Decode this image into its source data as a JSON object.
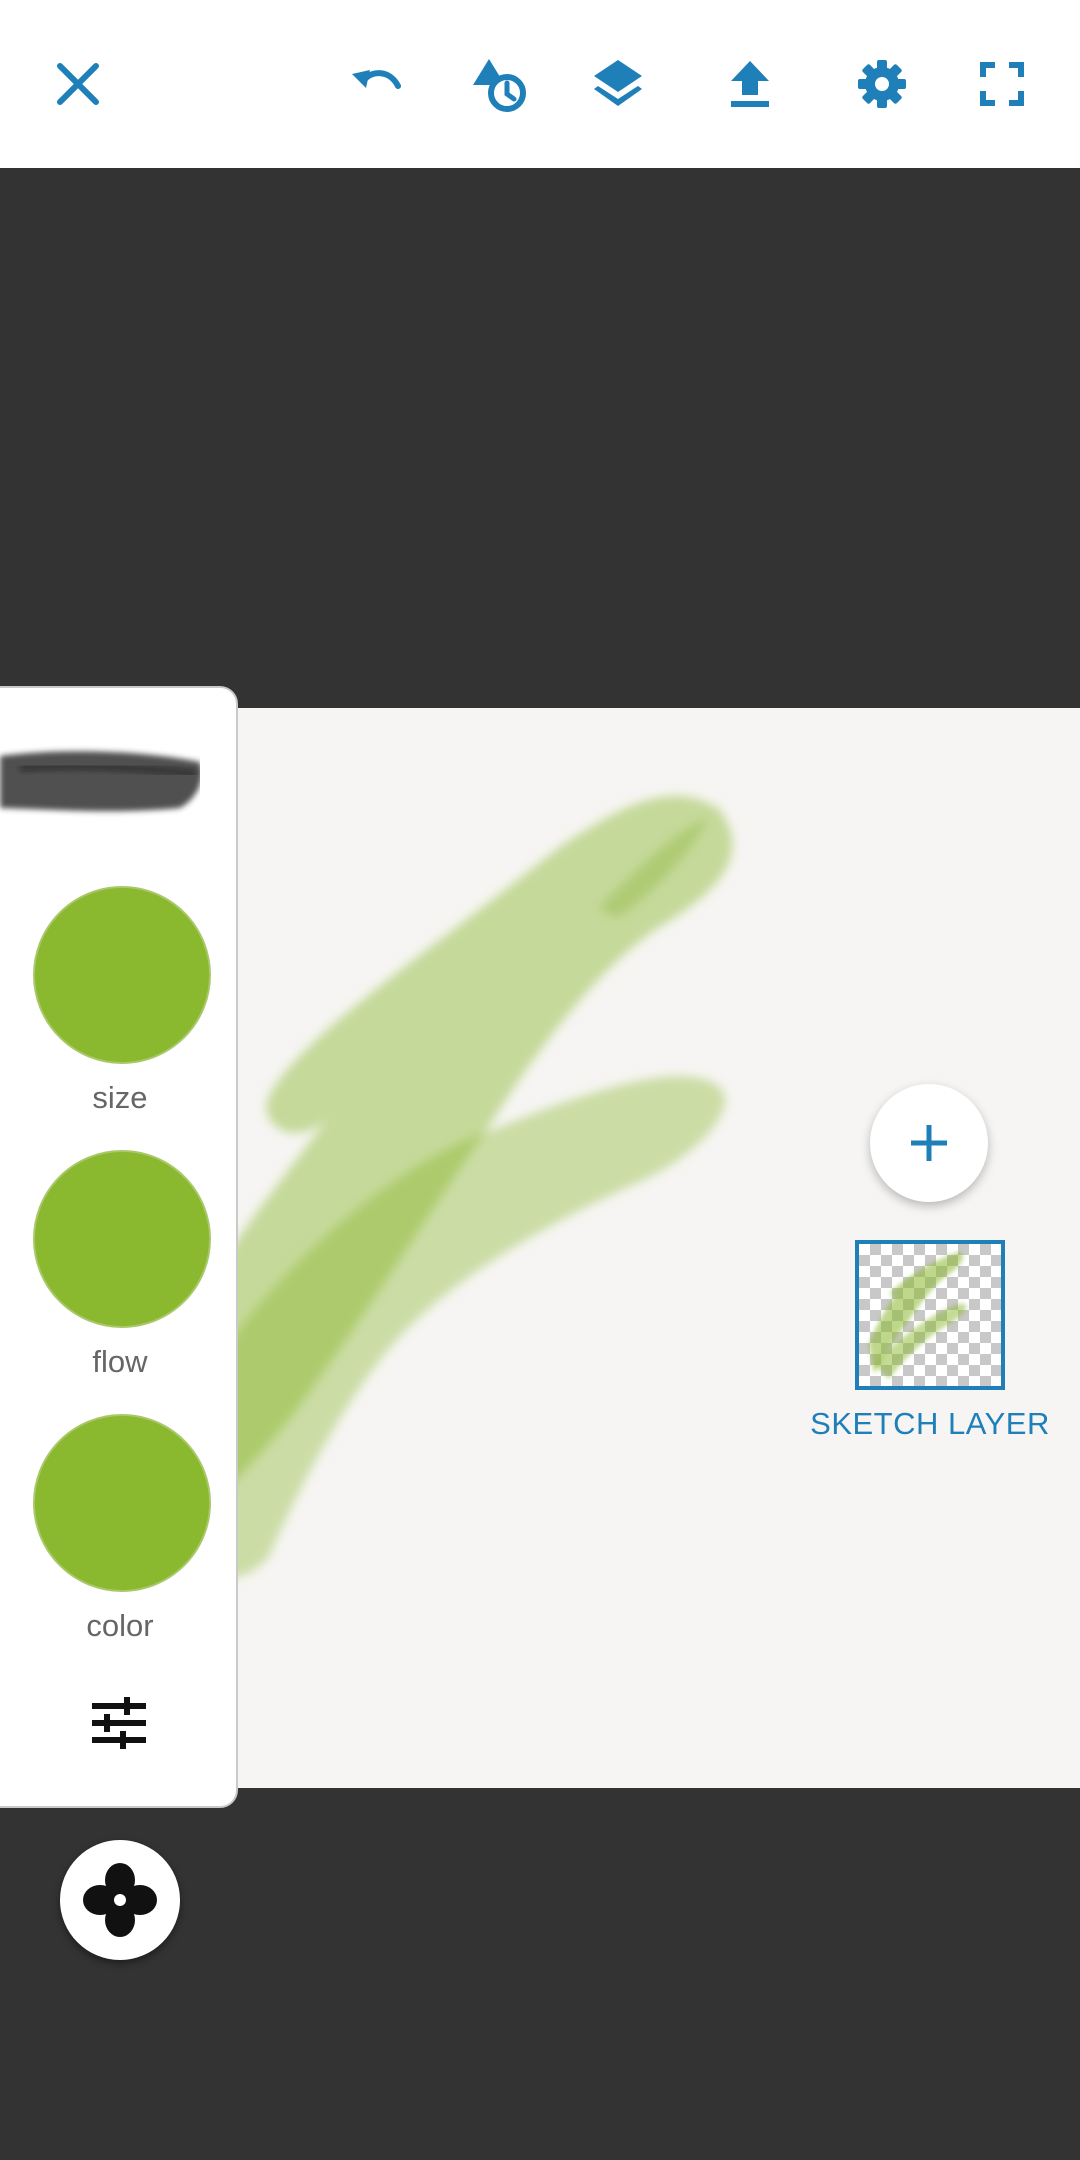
{
  "toolbar": {
    "buttons": [
      {
        "name": "close",
        "icon": "close-icon"
      },
      {
        "name": "undo",
        "icon": "undo-icon"
      },
      {
        "name": "shapes",
        "icon": "shapes-history-icon"
      },
      {
        "name": "layers",
        "icon": "layers-icon"
      },
      {
        "name": "share",
        "icon": "upload-icon"
      },
      {
        "name": "settings",
        "icon": "gear-icon"
      },
      {
        "name": "fullscreen",
        "icon": "fullscreen-icon"
      }
    ],
    "icon_color": "#1e7fb9"
  },
  "brush_panel": {
    "size_label": "size",
    "flow_label": "flow",
    "color_label": "color",
    "swatch_color": "#8ab82e",
    "settings_icon": "sliders-icon"
  },
  "tool_button": {
    "icon": "brush-tool-icon"
  },
  "layers": {
    "add_icon": "plus-icon",
    "items": [
      {
        "label": "SKETCH LAYER",
        "selected": true
      }
    ]
  },
  "colors": {
    "background": "#333333",
    "canvas": "#f6f5f3",
    "accent": "#1e7fb9",
    "paint": "#8ab82e"
  }
}
